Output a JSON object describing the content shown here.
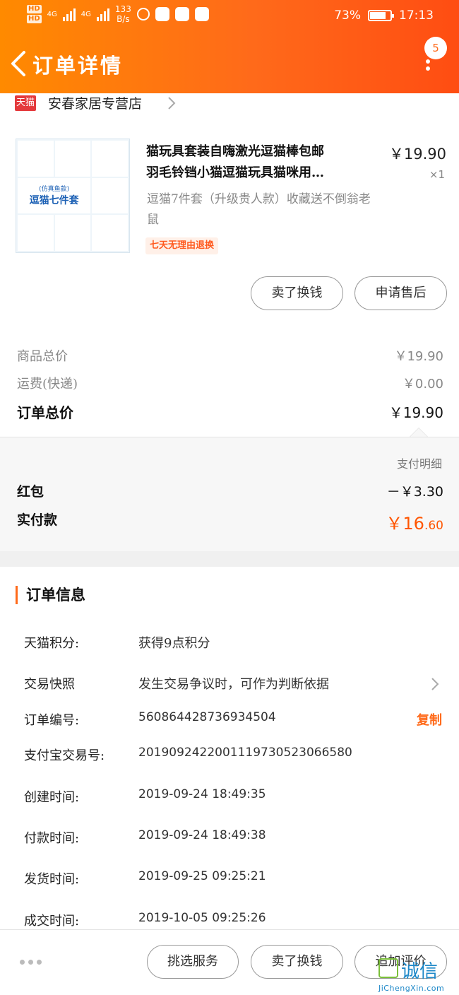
{
  "status_bar": {
    "net_speed": "133",
    "net_unit": "B/s",
    "signal_1": "4G",
    "signal_2": "4G",
    "hd": "HD",
    "battery": "73%",
    "time": "17:13"
  },
  "header": {
    "title": "订单详情",
    "message_count": "5"
  },
  "store": {
    "platform_tag": "天猫",
    "name": "安春家居专营店"
  },
  "product": {
    "title_line1": "猫玩具套装自嗨激光逗猫棒包邮",
    "title_line2": "羽毛铃铛小猫逗猫玩具猫咪用…",
    "price": "￥19.90",
    "quantity": "×1",
    "spec": "逗猫7件套（升级贵人款）收藏送不倒翁老鼠",
    "return_badge": "七天无理由退换",
    "image_caption": "逗猫七件套",
    "image_subcaption": "(仿真鱼款)"
  },
  "product_actions": {
    "resell": "卖了换钱",
    "after_sale": "申请售后"
  },
  "fees": {
    "goods_total_label": "商品总价",
    "goods_total_value": "￥19.90",
    "shipping_label": "运费(快递)",
    "shipping_value": "￥0.00",
    "order_total_label": "订单总价",
    "order_total_value": "￥19.90"
  },
  "payment": {
    "detail_label": "支付明细",
    "red_packet_label": "红包",
    "red_packet_value": "－￥3.30",
    "actual_label": "实付款",
    "actual_currency": "￥",
    "actual_int": "16",
    "actual_dec": ".60"
  },
  "order_info": {
    "title": "订单信息",
    "rows": [
      {
        "label": "天猫积分:",
        "value": "获得9点积分"
      },
      {
        "label": "交易快照",
        "value": "发生交易争议时，可作为判断依据"
      },
      {
        "label": "订单编号:",
        "value": "560864428736934504"
      },
      {
        "label": "支付宝交易号:",
        "value": "2019092422001119730523066580"
      },
      {
        "label": "创建时间:",
        "value": "2019-09-24 18:49:35"
      },
      {
        "label": "付款时间:",
        "value": "2019-09-24 18:49:38"
      },
      {
        "label": "发货时间:",
        "value": "2019-09-25 09:25:21"
      },
      {
        "label": "成交时间:",
        "value": "2019-10-05 09:25:26"
      }
    ],
    "copy_label": "复制"
  },
  "bottom_actions": {
    "pick_service": "挑选服务",
    "resell": "卖了换钱",
    "add_review": "追加评价"
  },
  "watermark": {
    "text": "诚信",
    "url": "JiChengXin.com"
  },
  "colors": {
    "accent": "#ff6a1a",
    "price_highlight": "#ff5500",
    "tmall_red": "#e4393c"
  }
}
